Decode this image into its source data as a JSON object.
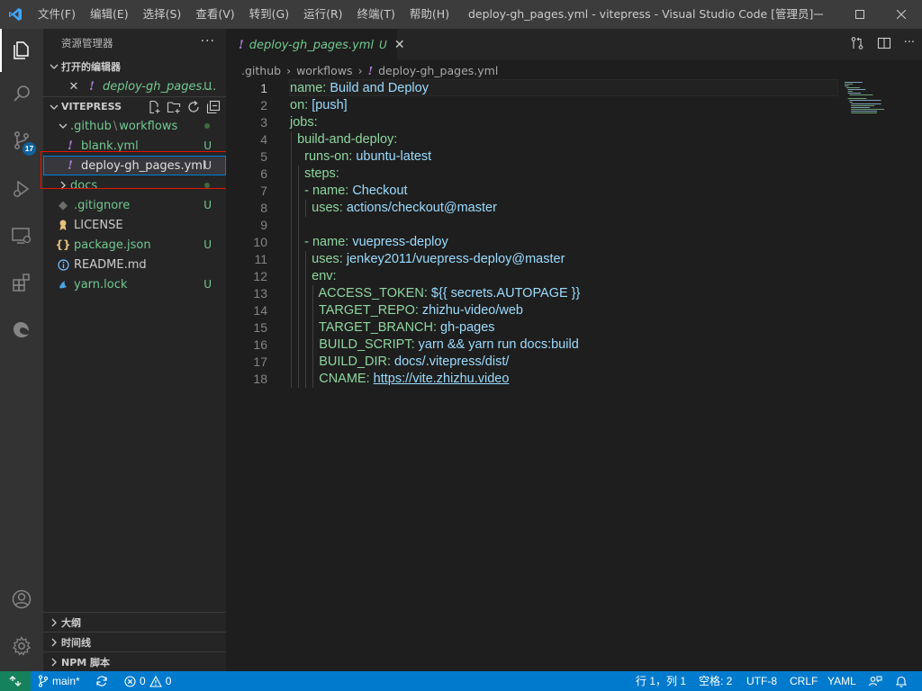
{
  "window": {
    "title": "deploy-gh_pages.yml - vitepress - Visual Studio Code [管理员]",
    "menu": [
      "文件(F)",
      "编辑(E)",
      "选择(S)",
      "查看(V)",
      "转到(G)",
      "运行(R)",
      "终端(T)",
      "帮助(H)"
    ]
  },
  "activity": {
    "scm_badge": "17"
  },
  "sidebar": {
    "title": "资源管理器",
    "open_editors": {
      "header": "打开的编辑器",
      "items": [
        {
          "name": "deploy-gh_pages....",
          "status": "U"
        }
      ]
    },
    "project": {
      "header": "VITEPRESS",
      "folder_path": ".github",
      "folder_sep": "\\",
      "folder_sub": "workflows",
      "files": [
        {
          "name": "blank.yml",
          "status": "U"
        },
        {
          "name": "deploy-gh_pages.yml",
          "status": "U"
        }
      ],
      "docs": "docs",
      "root_files": [
        {
          "name": ".gitignore",
          "status": "U"
        },
        {
          "name": "LICENSE",
          "status": ""
        },
        {
          "name": "package.json",
          "status": "U"
        },
        {
          "name": "README.md",
          "status": ""
        },
        {
          "name": "yarn.lock",
          "status": "U"
        }
      ]
    },
    "bottom_sections": [
      "大纲",
      "时间线",
      "NPM 脚本"
    ]
  },
  "editor": {
    "tab": {
      "label": "deploy-gh_pages.yml",
      "status": "U"
    },
    "breadcrumb": [
      ".github",
      "workflows",
      "deploy-gh_pages.yml"
    ],
    "lines": [
      {
        "indent": "",
        "key": "name:",
        "value": " Build and Deploy"
      },
      {
        "indent": "",
        "key": "on:",
        "value": " [push]"
      },
      {
        "indent": "",
        "key": "jobs:",
        "value": ""
      },
      {
        "indent": "  ",
        "key": "build-and-deploy:",
        "value": ""
      },
      {
        "indent": "    ",
        "key": "runs-on:",
        "value": " ubuntu-latest"
      },
      {
        "indent": "    ",
        "key": "steps:",
        "value": ""
      },
      {
        "indent": "    ",
        "key": "- name:",
        "value": " Checkout"
      },
      {
        "indent": "      ",
        "key": "uses:",
        "value": " actions/checkout@master"
      },
      {
        "indent": "",
        "key": "",
        "value": ""
      },
      {
        "indent": "    ",
        "key": "- name:",
        "value": " vuepress-deploy"
      },
      {
        "indent": "      ",
        "key": "uses:",
        "value": " jenkey2011/vuepress-deploy@master"
      },
      {
        "indent": "      ",
        "key": "env:",
        "value": ""
      },
      {
        "indent": "        ",
        "key": "ACCESS_TOKEN:",
        "value": " ${{ secrets.AUTOPAGE }}"
      },
      {
        "indent": "        ",
        "key": "TARGET_REPO:",
        "value": " zhizhu-video/web"
      },
      {
        "indent": "        ",
        "key": "TARGET_BRANCH:",
        "value": " gh-pages"
      },
      {
        "indent": "        ",
        "key": "BUILD_SCRIPT:",
        "value": " yarn && yarn run docs:build"
      },
      {
        "indent": "        ",
        "key": "BUILD_DIR:",
        "value": " docs/.vitepress/dist/"
      },
      {
        "indent": "        ",
        "key": "CNAME:",
        "value": " ",
        "link": "https://vite.zhizhu.video"
      }
    ]
  },
  "status": {
    "branch": "main*",
    "errors": "0",
    "warnings": "0",
    "position": "行 1，列 1",
    "spaces": "空格: 2",
    "encoding": "UTF-8",
    "eol": "CRLF",
    "language": "YAML"
  },
  "colors": {
    "accent": "#007acc",
    "remote": "#16825d",
    "untracked": "#73c991",
    "yaml_key": "#8fd6a0",
    "yaml_value": "#9cdcfe",
    "highlight_box": "#e51400"
  }
}
